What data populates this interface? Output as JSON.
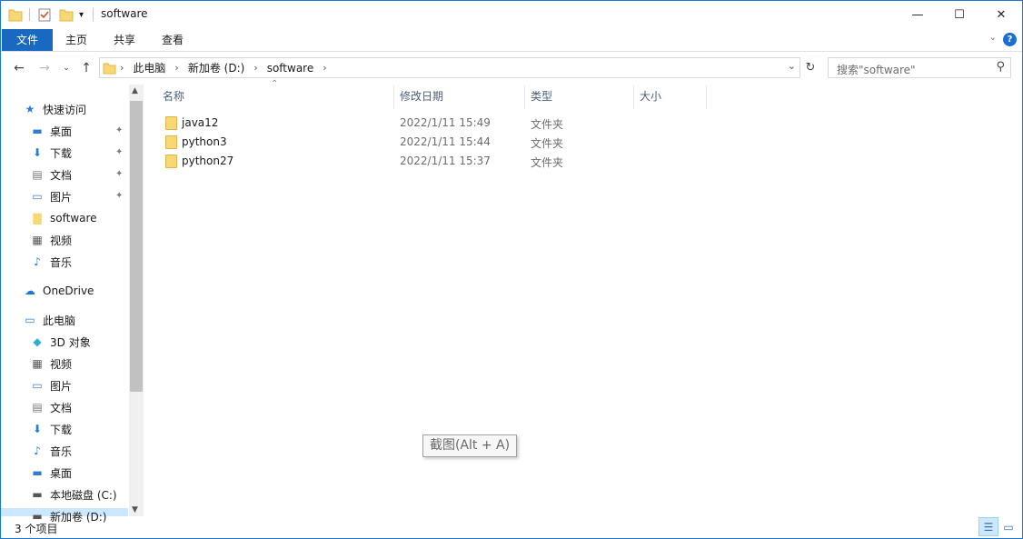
{
  "window": {
    "title": "software",
    "controls": {
      "minimize": "—",
      "maximize": "☐",
      "close": "✕"
    }
  },
  "quick_access_toolbar": {
    "icons": [
      "folder-icon",
      "properties-icon",
      "new-folder-icon",
      "customize-icon"
    ]
  },
  "ribbon": {
    "tabs": [
      "文件",
      "主页",
      "共享",
      "查看"
    ],
    "help": "?"
  },
  "address": {
    "crumbs": [
      "此电脑",
      "新加卷 (D:)",
      "software"
    ],
    "search_placeholder": "搜索\"software\""
  },
  "nav": {
    "quick_access": "快速访问",
    "quick_items": [
      {
        "label": "桌面",
        "icon": "desktop-icon",
        "pinned": true
      },
      {
        "label": "下载",
        "icon": "download-icon",
        "pinned": true
      },
      {
        "label": "文档",
        "icon": "document-icon",
        "pinned": true
      },
      {
        "label": "图片",
        "icon": "pictures-icon",
        "pinned": true
      },
      {
        "label": "software",
        "icon": "folder-icon",
        "pinned": false
      },
      {
        "label": "视频",
        "icon": "video-icon",
        "pinned": false
      },
      {
        "label": "音乐",
        "icon": "music-icon",
        "pinned": false
      }
    ],
    "onedrive": "OneDrive",
    "this_pc": "此电脑",
    "pc_items": [
      {
        "label": "3D 对象",
        "icon": "3d-objects-icon"
      },
      {
        "label": "视频",
        "icon": "video-icon"
      },
      {
        "label": "图片",
        "icon": "pictures-icon"
      },
      {
        "label": "文档",
        "icon": "document-icon"
      },
      {
        "label": "下载",
        "icon": "download-icon"
      },
      {
        "label": "音乐",
        "icon": "music-icon"
      },
      {
        "label": "桌面",
        "icon": "desktop-icon"
      },
      {
        "label": "本地磁盘 (C:)",
        "icon": "drive-icon"
      },
      {
        "label": "新加卷 (D:)",
        "icon": "drive-icon"
      }
    ]
  },
  "columns": [
    "名称",
    "修改日期",
    "类型",
    "大小"
  ],
  "files": [
    {
      "name": "java12",
      "date": "2022/1/11 15:49",
      "type": "文件夹"
    },
    {
      "name": "python3",
      "date": "2022/1/11 15:44",
      "type": "文件夹"
    },
    {
      "name": "python27",
      "date": "2022/1/11 15:37",
      "type": "文件夹"
    }
  ],
  "tooltip": "截图(Alt + A)",
  "status": {
    "count": "3 个项目"
  },
  "colors": {
    "accent": "#1969c0",
    "folder": "#f8d775",
    "selection": "#cce8ff"
  }
}
